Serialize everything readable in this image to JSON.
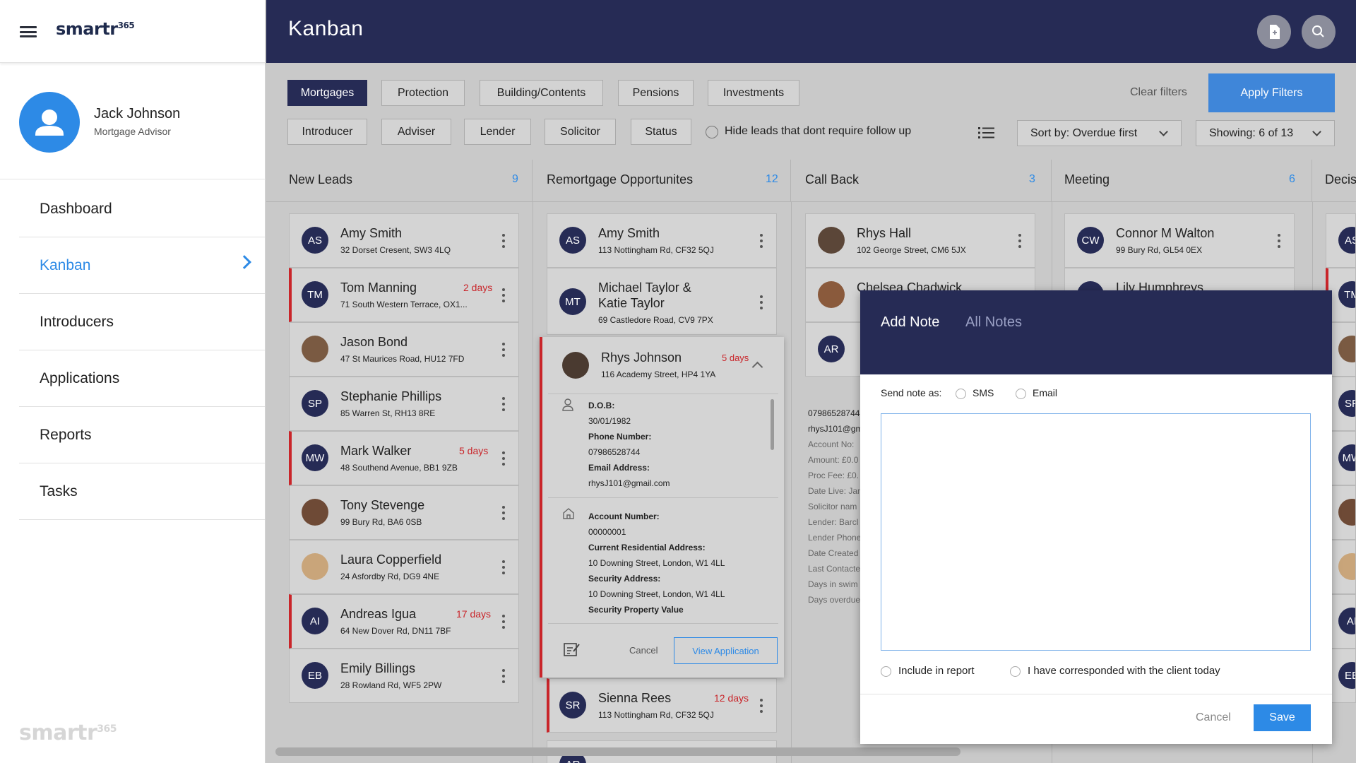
{
  "app": {
    "logo_text": "smartr",
    "logo_sup": "365",
    "page_title": "Kanban"
  },
  "user": {
    "name": "Jack Johnson",
    "role": "Mortgage Advisor"
  },
  "nav": [
    {
      "label": "Dashboard"
    },
    {
      "label": "Kanban",
      "active": true
    },
    {
      "label": "Introducers"
    },
    {
      "label": "Applications"
    },
    {
      "label": "Reports"
    },
    {
      "label": "Tasks"
    }
  ],
  "filters": {
    "categories": [
      "Mortgages",
      "Protection",
      "Building/Contents",
      "Pensions",
      "Investments"
    ],
    "active_category": "Mortgages",
    "fields": [
      "Introducer",
      "Adviser",
      "Lender",
      "Solicitor",
      "Status"
    ],
    "hide_leads_label": "Hide leads that dont require follow up",
    "clear_label": "Clear filters",
    "apply_label": "Apply Filters",
    "sort_label": "Sort by: Overdue first",
    "showing_label": "Showing: 6 of 13"
  },
  "columns": [
    {
      "name": "New Leads",
      "count": "9"
    },
    {
      "name": "Remortgage Opportunites",
      "count": "12"
    },
    {
      "name": "Call Back",
      "count": "3"
    },
    {
      "name": "Meeting",
      "count": "6"
    },
    {
      "name": "Decis"
    }
  ],
  "new_leads": [
    {
      "initials": "AS",
      "name": "Amy Smith",
      "address": "32 Dorset Cresent, SW3 4LQ",
      "days": "",
      "overdue": false
    },
    {
      "initials": "TM",
      "name": "Tom Manning",
      "address": "71 South Western Terrace, OX1...",
      "days": "2 days",
      "overdue": true
    },
    {
      "initials": "",
      "name": "Jason Bond",
      "address": "47 St Maurices Road, HU12 7FD",
      "days": "",
      "overdue": false,
      "photo": true
    },
    {
      "initials": "SP",
      "name": "Stephanie Phillips",
      "address": "85 Warren St, RH13 8RE",
      "days": "",
      "overdue": false
    },
    {
      "initials": "MW",
      "name": "Mark Walker",
      "address": "48 Southend Avenue, BB1 9ZB",
      "days": "5 days",
      "overdue": true
    },
    {
      "initials": "",
      "name": "Tony Stevenge",
      "address": "99 Bury Rd, BA6 0SB",
      "days": "",
      "overdue": false,
      "photo": true
    },
    {
      "initials": "",
      "name": "Laura Copperfield",
      "address": "24 Asfordby Rd, DG9 4NE",
      "days": "",
      "overdue": false,
      "photo": true
    },
    {
      "initials": "AI",
      "name": "Andreas Igua",
      "address": "64 New Dover Rd, DN11 7BF",
      "days": "17 days",
      "overdue": true
    },
    {
      "initials": "EB",
      "name": "Emily Billings",
      "address": "28 Rowland Rd, WF5 2PW",
      "days": "",
      "overdue": false
    }
  ],
  "remortgage": {
    "cards": [
      {
        "initials": "AS",
        "name": "Amy Smith",
        "address": "113 Nottingham Rd, CF32 5QJ"
      },
      {
        "initials": "MT",
        "name_line1": "Michael Taylor &",
        "name_line2": "Katie Taylor",
        "address": "69 Castledore Road, CV9 7PX"
      }
    ],
    "expanded": {
      "name": "Rhys Johnson",
      "address": "116 Academy Street, HP4 1YA",
      "days": "5 days",
      "dob_label": "D.O.B:",
      "dob": "30/01/1982",
      "phone_label": "Phone Number:",
      "phone": "07986528744",
      "email_label": "Email Address:",
      "email": "rhysJ101@gmail.com",
      "account_label": "Account Number:",
      "account": "00000001",
      "residential_label": "Current Residential Address:",
      "residential": "10 Downing Street, London, W1 4LL",
      "security_label": "Security Address:",
      "security": "10 Downing Street, London, W1 4LL",
      "security_value_label": "Security Property Value",
      "cancel_label": "Cancel",
      "view_label": "View Application"
    },
    "bottom_card": {
      "initials": "SR",
      "name": "Sienna Rees",
      "address": "113 Nottingham Rd, CF32 5QJ",
      "days": "12 days"
    },
    "partial_card": {
      "initials": "AR"
    }
  },
  "call_back": {
    "cards": [
      {
        "name": "Rhys Hall",
        "address": "102 George Street, CM6 5JX"
      },
      {
        "name": "Chelsea Chadwick"
      },
      {
        "initials": "AR"
      }
    ],
    "details": [
      "07986528744",
      "rhysJ101@gm",
      "Account No:",
      "Amount: £0.0",
      "Proc Fee: £0.",
      "Date Live: Jan",
      "Solicitor nam",
      "Lender: Barcl",
      "Lender Phone",
      "Date Created",
      "Last Contacte",
      "Days in swim",
      "Days overdue"
    ]
  },
  "meeting": {
    "cards": [
      {
        "initials": "CW",
        "name": "Connor M Walton",
        "address": "99 Bury Rd, GL54 0EX"
      },
      {
        "name": "Lily Humphreys"
      }
    ]
  },
  "decision": {
    "initials": [
      "AS",
      "TM",
      "",
      "SP",
      "MW",
      "",
      "",
      "AI",
      "EB"
    ]
  },
  "note_modal": {
    "tab_add": "Add Note",
    "tab_all": "All Notes",
    "send_as_label": "Send note as:",
    "sms": "SMS",
    "email": "Email",
    "include_report": "Include in report",
    "corresponded": "I have corresponded with the client today",
    "cancel": "Cancel",
    "save": "Save"
  },
  "colors": {
    "navy": "#262b55",
    "accent": "#2d8ae6",
    "overdue": "#c9252a"
  }
}
